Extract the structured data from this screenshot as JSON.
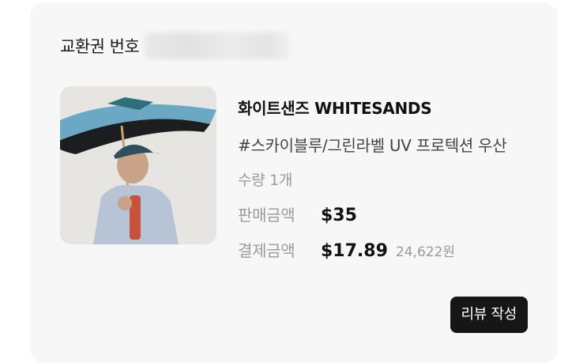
{
  "order": {
    "voucher_label": "교환권 번호",
    "brand": "화이트샌즈 WHITESANDS",
    "product_title": "#스카이블루/그린라벨 UV 프로텍션 우산",
    "quantity": "수량 1개",
    "sale_price_label": "판매금액",
    "sale_price": "$35",
    "paid_label": "결제금액",
    "paid_price": "$17.89",
    "paid_krw": "24,622원",
    "review_button": "리뷰 작성"
  },
  "icons": {
    "product_image": "man-holding-umbrella-photo"
  },
  "colors": {
    "card_background": "#f7f7f7",
    "button_background": "#161616",
    "muted_text": "#9a9a9a"
  }
}
